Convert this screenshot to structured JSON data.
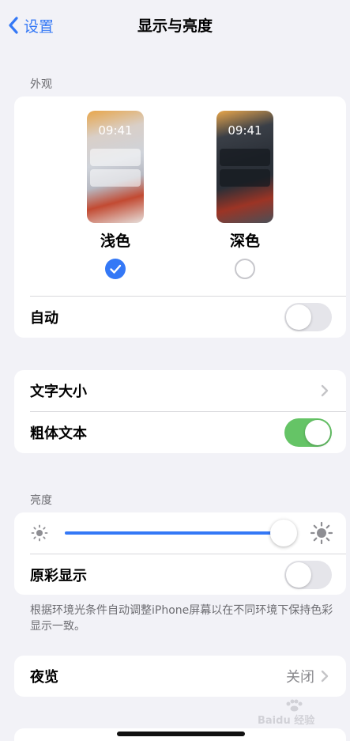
{
  "nav": {
    "back_label": "设置",
    "title": "显示与亮度"
  },
  "appearance": {
    "section_label": "外观",
    "light": {
      "time": "09:41",
      "label": "浅色",
      "selected": true
    },
    "dark": {
      "time": "09:41",
      "label": "深色",
      "selected": false
    },
    "auto": {
      "label": "自动",
      "on": false
    }
  },
  "text": {
    "text_size_label": "文字大小",
    "bold_text": {
      "label": "粗体文本",
      "on": true
    }
  },
  "brightness": {
    "section_label": "亮度",
    "level_fraction": 0.95,
    "true_tone": {
      "label": "原彩显示",
      "on": false
    },
    "footnote": "根据环境光条件自动调整iPhone屏幕以在不同环境下保持色彩显示一致。"
  },
  "night_shift": {
    "label": "夜览",
    "value": "关闭"
  },
  "watermark": {
    "text": "Baidu 经验"
  },
  "colors": {
    "accent": "#3478f6",
    "toggle_on": "#65c466"
  }
}
